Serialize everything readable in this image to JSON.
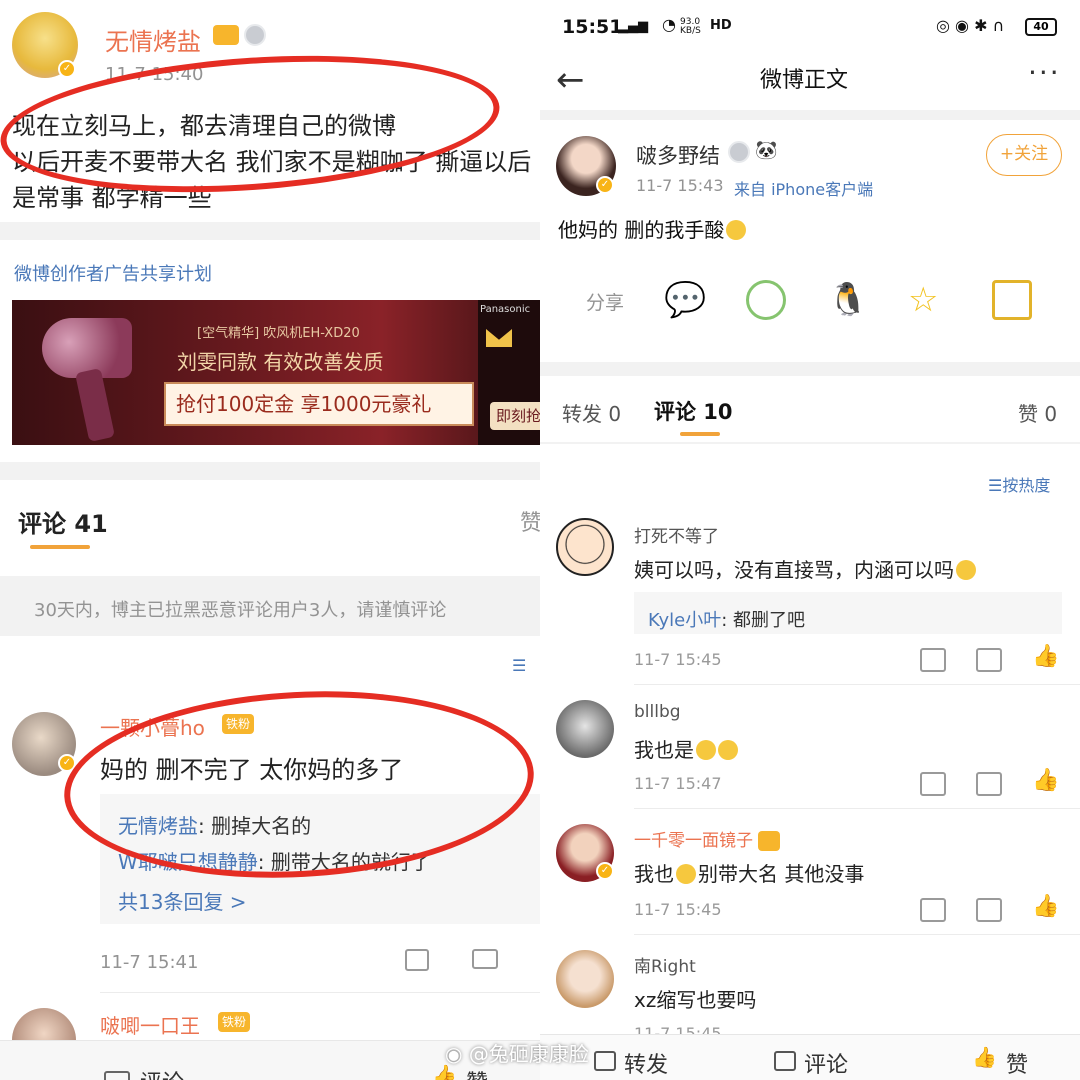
{
  "left": {
    "post": {
      "author": "无情烤盐",
      "time": "11-7 15:40",
      "text_line1": "现在立刻马上，都去清理自己的微博",
      "text_line2": "以后开麦不要带大名 我们家不是糊咖了 撕逼以后",
      "text_line3": "是常事 都学精一些"
    },
    "ad": {
      "program": "微博创作者广告共享计划",
      "product": "[空气精华] 吹风机EH-XD20",
      "headline": "刘雯同款  有效改善发质",
      "promo": "抢付100定金 享1000元豪礼",
      "brand": "Panasonic",
      "cta": "即刻抢"
    },
    "comments_header": {
      "label": "评论 41",
      "like_partial": "赞"
    },
    "notice": "30天内，博主已拉黑恶意评论用户3人，请谨慎评论",
    "comment1": {
      "user": "一颗小瞢ho",
      "fan_badge": "铁粉",
      "text": "妈的 删不完了 太你妈的多了",
      "reply1_user": "无情烤盐",
      "reply1_text": ": 删掉大名的",
      "reply2_user": "W耶啵只想静静",
      "reply2_text": ": 删带大名的就行了",
      "more_replies": "共13条回复 >",
      "time": "11-7 15:41"
    },
    "comment2": {
      "user": "啵唧一口王",
      "fan_badge": "铁粉"
    },
    "bottom_bar": {
      "comment": "评论",
      "like": "赞"
    }
  },
  "right": {
    "status_bar": {
      "time": "15:51",
      "speed": "93.0 KB/S",
      "battery": "40"
    },
    "nav": {
      "title": "微博正文"
    },
    "post": {
      "author": "啵多野结",
      "time": "11-7 15:43",
      "source": "来自 iPhone客户端",
      "text": "他妈的 删的我手酸",
      "follow_label": "+关注",
      "share_label": "分享"
    },
    "tabs": {
      "repost": "转发 0",
      "comment": "评论 10",
      "like": "赞 0",
      "sort": "按热度"
    },
    "comments": [
      {
        "user": "打死不等了",
        "text": "姨可以吗，没有直接骂，内涵可以吗",
        "reply_user": "Kyle小叶",
        "reply_text": ": 都删了吧",
        "time": "11-7 15:45"
      },
      {
        "user": "blllbg",
        "text": "我也是",
        "time": "11-7 15:47"
      },
      {
        "user": "一千零一面镜子",
        "text_before": "我也",
        "text_after": "别带大名 其他没事",
        "time": "11-7 15:45"
      },
      {
        "user": "南Right",
        "text": "xz缩写也要吗",
        "time": "11-7 15:45"
      }
    ],
    "bottom_bar": {
      "repost": "转发",
      "comment": "评论",
      "like": "赞"
    }
  },
  "watermark": "@兔砸康康脸",
  "colors": {
    "accent_orange": "#eb7350",
    "link_blue": "#4a78b8",
    "follow_orange": "#f1a33a",
    "annotation_red": "#e52d23"
  }
}
